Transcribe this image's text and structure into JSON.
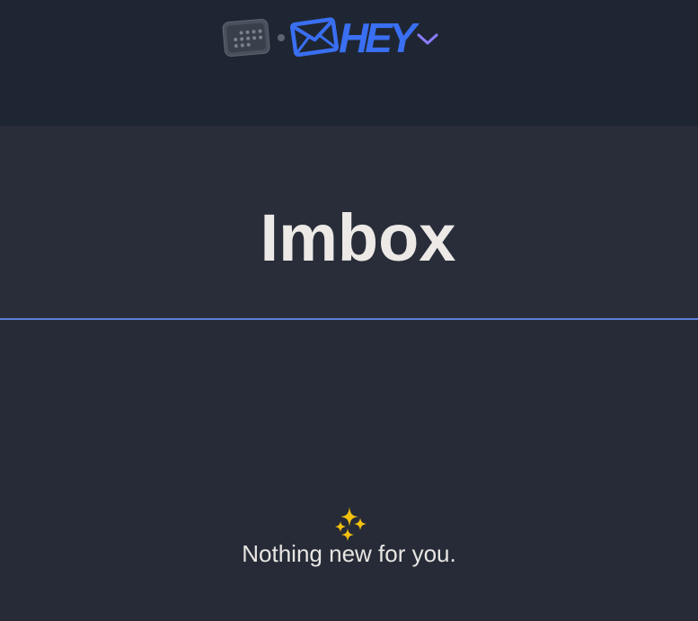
{
  "topbar": {
    "calendar_icon": "calendar-icon",
    "hey_logo_text": "HEY",
    "envelope_icon": "envelope-icon",
    "switcher_icon": "chevron-down-icon",
    "accent_color": "#3a6ff2"
  },
  "page": {
    "title": "Imbox"
  },
  "empty_state": {
    "icon": "sparkles-icon",
    "message": "Nothing new for you."
  },
  "colors": {
    "topbar_bg": "#1f2633",
    "body_bg": "#262b37",
    "divider": "#5d7fd9",
    "title_text": "#ece9e6"
  }
}
